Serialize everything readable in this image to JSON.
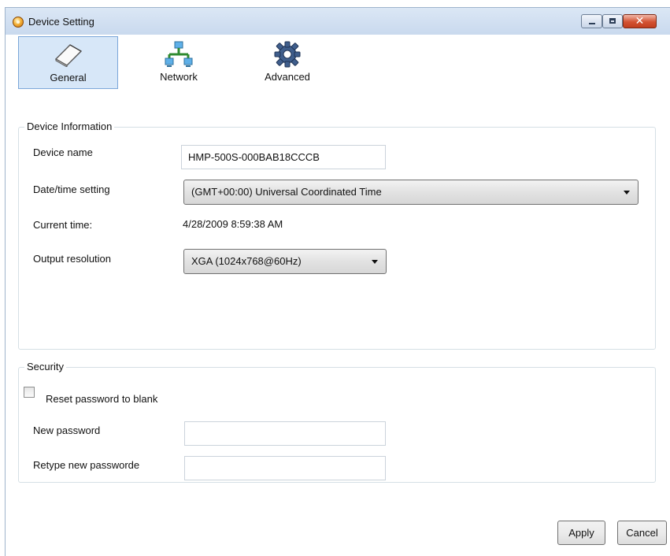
{
  "window": {
    "title": "Device Setting"
  },
  "toolbar": {
    "tabs": [
      {
        "label": "General",
        "icon": "notepad-icon",
        "selected": true
      },
      {
        "label": "Network",
        "icon": "network-icon",
        "selected": false
      },
      {
        "label": "Advanced",
        "icon": "gear-icon",
        "selected": false
      }
    ]
  },
  "device_info": {
    "legend": "Device Information",
    "device_name_label": "Device name",
    "device_name_value": "HMP-500S-000BAB18CCCB",
    "datetime_label": "Date/time setting",
    "datetime_value": "(GMT+00:00) Universal Coordinated Time",
    "current_time_label": "Current time:",
    "current_time_value": "4/28/2009 8:59:38 AM",
    "output_label": "Output resolution",
    "output_value": "XGA (1024x768@60Hz)"
  },
  "security": {
    "legend": "Security",
    "reset_label": "Reset password to blank",
    "reset_checked": false,
    "new_password_label": "New password",
    "retype_label": "Retype new passworde",
    "new_password_value": "",
    "retype_value": ""
  },
  "buttons": {
    "apply": "Apply",
    "cancel": "Cancel"
  },
  "colors": {
    "selected_tab_bg": "#d7e7f8",
    "selected_tab_border": "#7ca7d9",
    "close_button": "#c9482a"
  }
}
